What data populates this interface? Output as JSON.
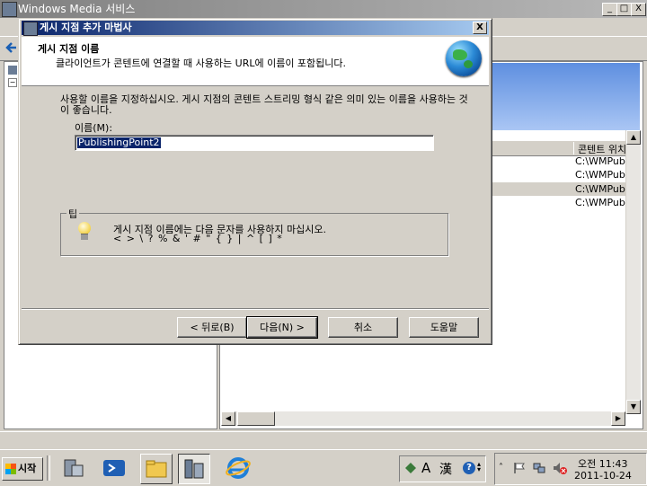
{
  "background_window": {
    "title": "Windows Media 서비스",
    "controls": {
      "minimize": "_",
      "maximize": "□",
      "close": "X"
    },
    "list_header": "콘텐트 위치",
    "list_rows": [
      "C:\\WMPub",
      "C:\\WMPub",
      "C:\\WMPub",
      "C:\\WMPub"
    ]
  },
  "dialog": {
    "title": "게시 지점 추가 마법사",
    "close_label": "X",
    "heading": "게시 지점 이름",
    "subheading": "클라이언트가 콘텐트에 연결할 때 사용하는 URL에 이름이 포함됩니다.",
    "instruction": "사용할 이름을 지정하십시오. 게시 지점의 콘텐트 스트리밍 형식 같은 의미 있는 이름을 사용하는 것이 좋습니다.",
    "name_label": "이름(M):",
    "name_value": "PublishingPoint2",
    "tips_label": "팁",
    "tips_line1": "게시 지점 이름에는 다음 문자를 사용하지 마십시오.",
    "tips_line2": "< > \\ ? % & ' # \" { } | ^ [ ] *",
    "buttons": {
      "back": "< 뒤로(B)",
      "next": "다음(N) >",
      "cancel": "취소",
      "help": "도움말"
    }
  },
  "taskbar": {
    "start_label": "시작",
    "language_indicator": "A",
    "hanja_indicator": "漢",
    "clock_time": "오전 11:43",
    "clock_date": "2011-10-24"
  },
  "colors": {
    "dialog_title_active": "#0a246a",
    "bg_title_inactive": "#808080",
    "face": "#d4d0c8",
    "selection": "#0a246a"
  }
}
